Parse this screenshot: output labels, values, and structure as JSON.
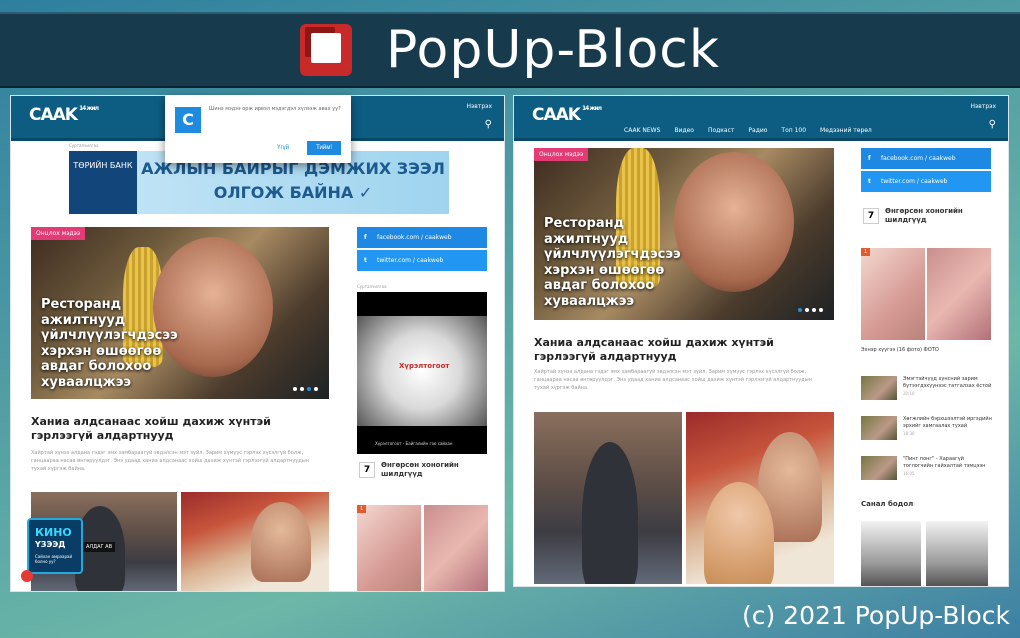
{
  "banner": {
    "title": "PopUp-Block"
  },
  "footer": {
    "copyright": "(c) 2021 PopUp-Block"
  },
  "site": {
    "brand": "CAAK",
    "brand_sub": "14 жил",
    "login": "Нэвтрэх",
    "menu": [
      "CAAK NEWS",
      "Видео",
      "Подкаст",
      "Радио",
      "Топ 100",
      "Медээний төрөл"
    ]
  },
  "popup": {
    "icon_letter": "C",
    "message": "Шинэ мэдээ орж ирвэл мэдэгдэл хүлээж авах уу?",
    "no_label": "Үгүй",
    "yes_label": "Тийм!"
  },
  "ad": {
    "label": "Сурталчилгаа",
    "bank": "ТӨРИЙН БАНК",
    "line1": "АЖЛЫН БАЙРЫГ ДЭМЖИХ ЗЭЭЛ",
    "line2": "ОЛГОЖ БАЙНА ✓"
  },
  "hero": {
    "badge": "Онцлох мэдээ",
    "headline": "Ресторанд ажилтнууд үйлчлүүлэгчдэсээ хэрхэн өшөөгөө авдаг болохоо хуваалцжээ"
  },
  "article": {
    "title": "Ханиа алдсанаас хойш дахиж хүнтэй гэрлээгүй алдартнууд",
    "body": "Хайртай хүнээ алдана гэдэг эмх замбараагүй эвдэлсэн мэт зүйл. Зарим хүмүүс гэрлэх хүсэлгүй болж, ганцаараа насаа өнгөрүүлдэг. Энэ удаад ханиа алдсанаас хойш дахиж хүнтэй гэрлээгүй алдартнуудын тухай хүргэж байна."
  },
  "social": {
    "facebook": "facebook.com / caakweb",
    "twitter": "twitter.com / caakweb"
  },
  "sidebar": {
    "ad_label": "Сурталчилгаа",
    "video_brand": "Хүрэлтогоот",
    "video_caption": "Хүрэлтогоот - Байгалийн гоо сайхан",
    "trend_num": "7",
    "trend_title": "Өнгөрсөн хоногийн шилдгүүд",
    "tile_tag": "1",
    "tile_caption": "Эхнэр хүүгээ (16 фото) ФОТО"
  },
  "kino": {
    "line1": "КИНО",
    "line2": "ҮЗЭЭД",
    "line3": "Сайхан амраарай болно уу?",
    "side": "АЛДАГ АВ"
  },
  "news_list": [
    {
      "title": "Эмэгтэйчүүд хүнсний зарим бүтээгдэхүүнээс татгалзах ёстой",
      "time": "20:10"
    },
    {
      "title": "Хөгжлийн бэрхшээлтэй иргэдийн эрхийг хамгаалах тухай",
      "time": "18:30"
    },
    {
      "title": "\"Пинг понг\" - Хараагүй тоглогчийн гайхалтай тэмцээн",
      "time": "16:05"
    }
  ],
  "opinion": {
    "title": "Санал бодол"
  }
}
